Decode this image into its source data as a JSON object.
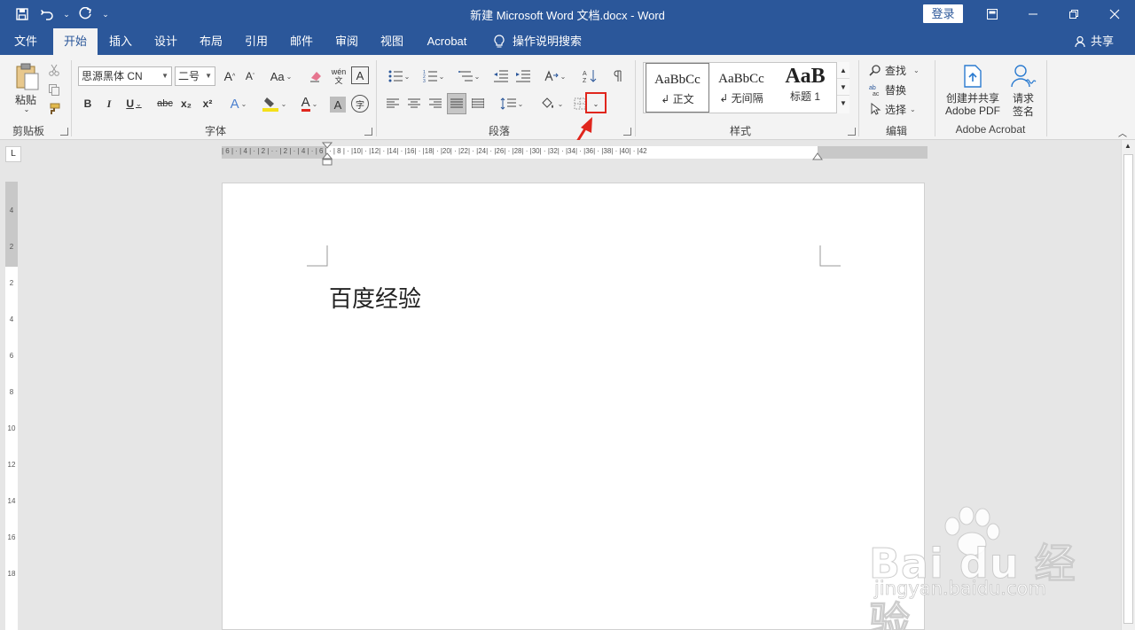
{
  "window": {
    "title": "新建 Microsoft Word 文档.docx  -  Word",
    "login": "登录"
  },
  "tabs": [
    "文件",
    "开始",
    "插入",
    "设计",
    "布局",
    "引用",
    "邮件",
    "审阅",
    "视图",
    "Acrobat"
  ],
  "active_tab": "开始",
  "tell_me": "操作说明搜索",
  "share": "共享",
  "ribbon": {
    "clipboard": {
      "paste": "粘贴",
      "label": "剪贴板"
    },
    "font": {
      "font_name": "思源黑体 CN",
      "font_size": "二号",
      "label": "字体",
      "bold": "B",
      "italic": "I",
      "underline": "U",
      "strike": "abc",
      "subscript": "x₂",
      "superscript": "x²",
      "grow": "A",
      "shrink": "A",
      "case": "Aa",
      "phonetic": "wén",
      "border_char": "A",
      "effects": "A",
      "font_color": "A",
      "shading": "A",
      "enclose": "字"
    },
    "paragraph": {
      "label": "段落"
    },
    "styles": {
      "label": "样式",
      "items": [
        {
          "sample": "AaBbCc",
          "name": "↲ 正文"
        },
        {
          "sample": "AaBbCc",
          "name": "↲ 无间隔"
        },
        {
          "sample": "AaB",
          "name": "标题 1"
        }
      ]
    },
    "editing": {
      "find": "查找",
      "replace": "替换",
      "select": "选择",
      "label": "编辑"
    },
    "acrobat": {
      "create": "创建并共享",
      "create2": "Adobe PDF",
      "sign": "请求",
      "sign2": "签名",
      "label": "Adobe Acrobat"
    }
  },
  "ruler": {
    "h_ticks": "| 6 |  · | 4 |  · | 2 |  ·    ·  | 2 |  · | 4 |  · | 6 |  · | 8 |  · |10|  · |12|  · |14|  · |16|  · |18|  · |20|  · |22|  · |24|  · |26|  · |28|  · |30|  · |32|  · |34|  · |36|  · |38|  · |40|  · |42",
    "v_ticks": [
      "4",
      "2",
      "",
      "2",
      "4",
      "6",
      "8",
      "10",
      "12",
      "14",
      "16",
      "18"
    ]
  },
  "document": {
    "text": "百度经验"
  },
  "watermark": {
    "brand": "Bai du 经验",
    "url": "jingyan.baidu.com"
  },
  "colors": {
    "accent": "#2b579a",
    "highlight": "#e0261d"
  }
}
